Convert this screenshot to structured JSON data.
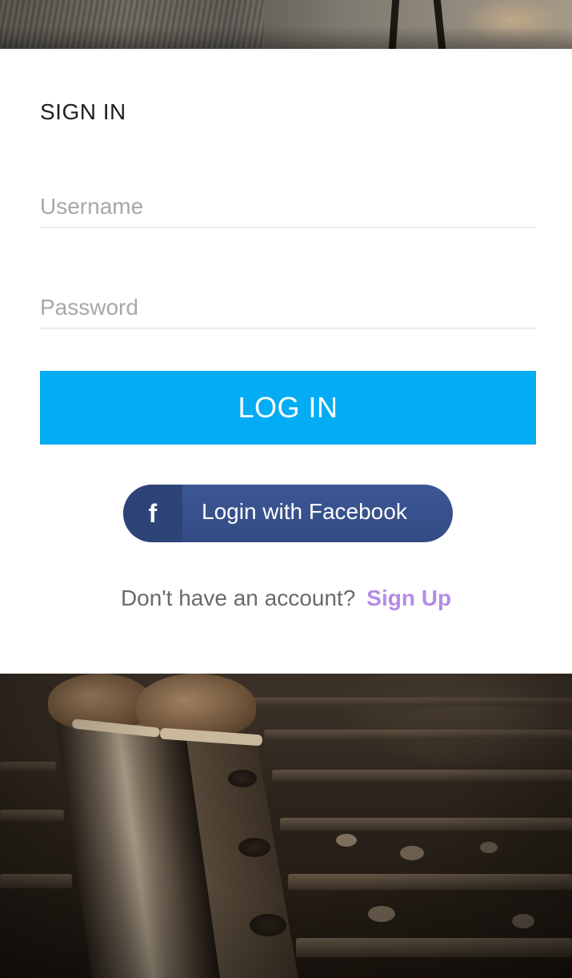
{
  "form": {
    "title": "SIGN IN",
    "username_placeholder": "Username",
    "username_value": "",
    "password_placeholder": "Password",
    "password_value": "",
    "login_label": "LOG IN"
  },
  "facebook": {
    "icon": "facebook-f-icon",
    "label": "Login with Facebook"
  },
  "signup": {
    "prompt": "Don't have an account?",
    "link": "Sign Up"
  },
  "colors": {
    "primary": "#03acf4",
    "facebook": "#3b5998",
    "signup_link": "#b48be8"
  }
}
